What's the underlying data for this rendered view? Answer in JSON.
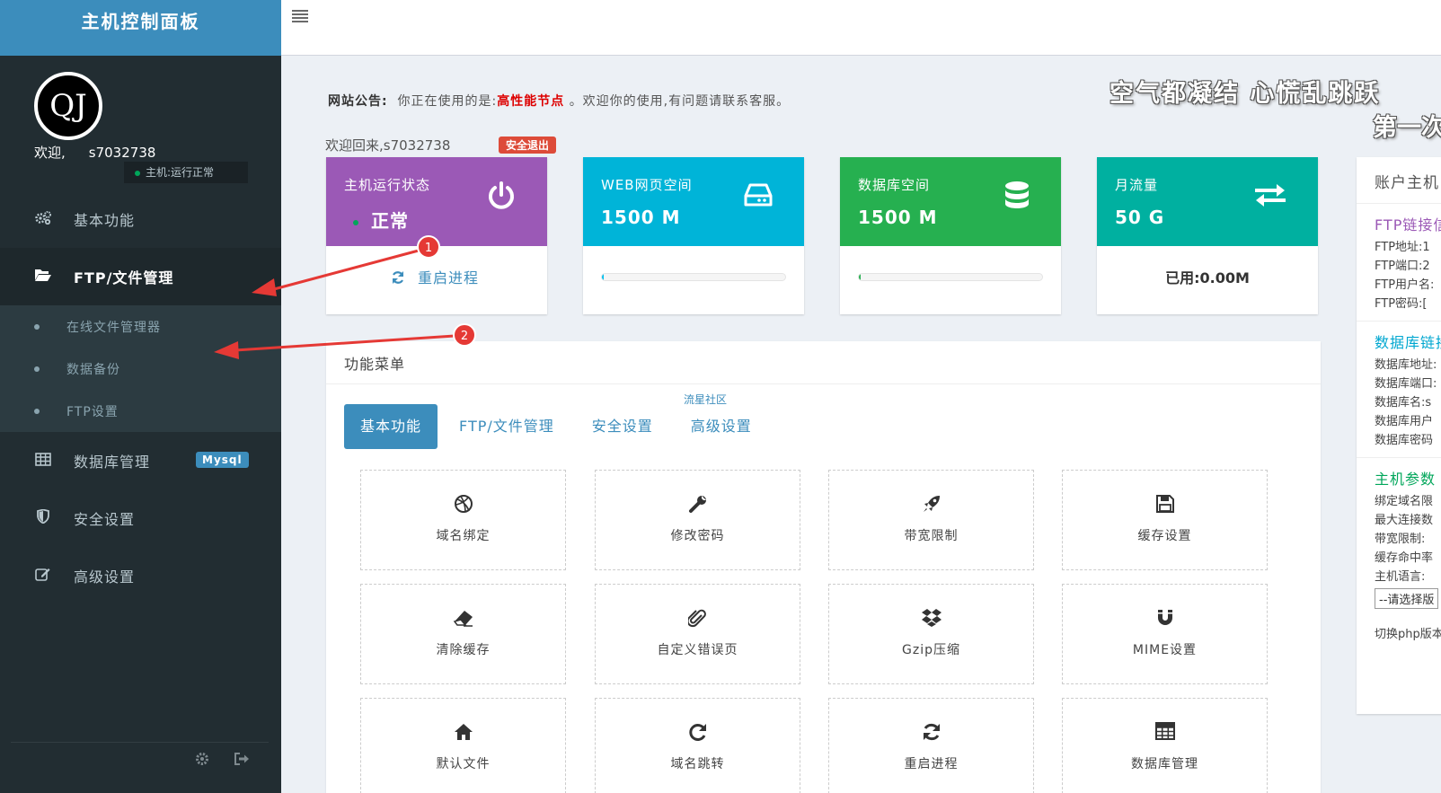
{
  "sidebar": {
    "logo": "主机控制面板",
    "avatar_text": "QJ",
    "welcome_label": "欢迎,",
    "username": "s7032738",
    "host_status": "主机:运行正常",
    "menu": [
      {
        "label": "基本功能",
        "icon": "cogs-icon"
      },
      {
        "label": "FTP/文件管理",
        "icon": "folder-open-icon"
      },
      {
        "label": "数据库管理",
        "icon": "table-icon",
        "badge": "Mysql"
      },
      {
        "label": "安全设置",
        "icon": "shield-icon"
      },
      {
        "label": "高级设置",
        "icon": "edit-icon"
      }
    ],
    "submenu": [
      "在线文件管理器",
      "数据备份",
      "FTP设置"
    ]
  },
  "topbar": {
    "menu_icon": "hamburger-icon"
  },
  "notice": {
    "label": "网站公告:",
    "text1": "你正在使用的是:",
    "highlight": "高性能节点",
    "text2": "。欢迎你的使用,有问题请联系客服。"
  },
  "marquee": {
    "line1": "空气都凝结 心慌乱跳跃",
    "line2": "第一次"
  },
  "welcome_back": "欢迎回来,s7032738",
  "logout_label": "安全退出",
  "cards": [
    {
      "title": "主机运行状态",
      "value": "正常",
      "color": "#9b59b6",
      "icon": "power-icon",
      "bottom": "重启进程"
    },
    {
      "title": "WEB网页空间",
      "value": "1500 M",
      "color": "#00b4d8",
      "icon": "hdd-icon",
      "progress": 0.01
    },
    {
      "title": "数据库空间",
      "value": "1500 M",
      "color": "#26b050",
      "icon": "database-icon",
      "progress": 0.01
    },
    {
      "title": "月流量",
      "value": "50 G",
      "color": "#00b0a0",
      "icon": "exchange-icon",
      "bottom": "已用:0.00M"
    }
  ],
  "annotations": [
    "1",
    "2"
  ],
  "panel": {
    "title": "功能菜单",
    "watermark": "流星社区",
    "tabs": [
      "基本功能",
      "FTP/文件管理",
      "安全设置",
      "高级设置"
    ],
    "items": [
      {
        "label": "域名绑定",
        "icon": "dribbble-icon"
      },
      {
        "label": "修改密码",
        "icon": "wrench-icon"
      },
      {
        "label": "带宽限制",
        "icon": "rocket-icon"
      },
      {
        "label": "缓存设置",
        "icon": "save-icon"
      },
      {
        "label": "清除缓存",
        "icon": "eraser-icon"
      },
      {
        "label": "自定义错误页",
        "icon": "paperclip-icon"
      },
      {
        "label": "Gzip压缩",
        "icon": "dropbox-icon"
      },
      {
        "label": "MIME设置",
        "icon": "magnet-icon"
      },
      {
        "label": "默认文件",
        "icon": "home-icon"
      },
      {
        "label": "域名跳转",
        "icon": "redo-icon"
      },
      {
        "label": "重启进程",
        "icon": "refresh-icon"
      },
      {
        "label": "数据库管理",
        "icon": "table-icon"
      }
    ]
  },
  "account": {
    "title": "账户主机",
    "ftp": {
      "title": "FTP链接信",
      "color": "#9b59b6",
      "lines": [
        "FTP地址:1",
        "FTP端口:2",
        "FTP用户名:",
        "FTP密码:["
      ]
    },
    "db": {
      "title": "数据库链接",
      "color": "#00a7d0",
      "lines": [
        "数据库地址:",
        "数据库端口:",
        "数据库名:s",
        "数据库用户",
        "数据库密码"
      ]
    },
    "host": {
      "title": "主机参数",
      "color": "#00a65a",
      "lines": [
        "绑定域名限",
        "最大连接数",
        "带宽限制:",
        "缓存命中率",
        "主机语言:"
      ],
      "select": "--请选择版",
      "php": "切换php版本"
    }
  }
}
